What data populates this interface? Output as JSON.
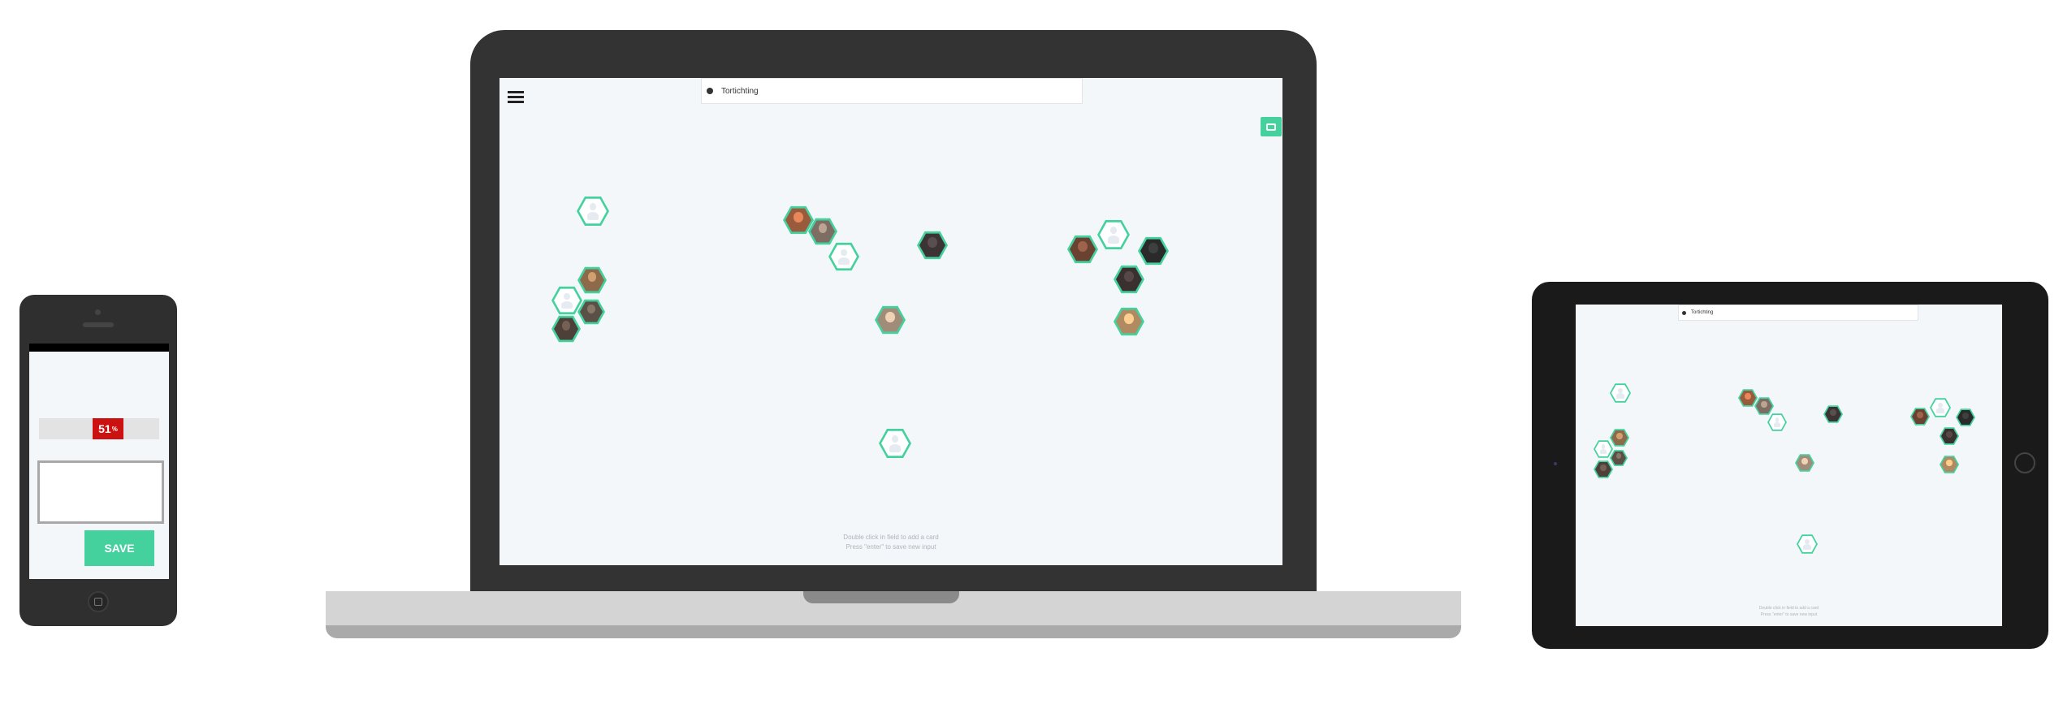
{
  "phone": {
    "progress": {
      "value": 0.51,
      "label": "51",
      "unit": "%"
    },
    "textbox": {
      "value": ""
    },
    "save_label": "SAVE"
  },
  "laptop": {
    "search": {
      "value": "Tortichting"
    },
    "hint_lines": [
      "Double click in field to add a card",
      "Press \"enter\" to save new input"
    ]
  },
  "tablet": {
    "search": {
      "value": "Tortichting"
    },
    "hint_lines": [
      "Double click in field to add a card",
      "Press \"enter\" to save new input"
    ]
  },
  "colors": {
    "accent": "#45d19e",
    "progress_red": "#cc1111",
    "device_dark": "#333333",
    "screen_bg": "#f4f7fa"
  },
  "icons": [
    "menu-icon",
    "chat-icon",
    "search-dot-icon",
    "avatar-placeholder-icon",
    "home-button-icon"
  ]
}
